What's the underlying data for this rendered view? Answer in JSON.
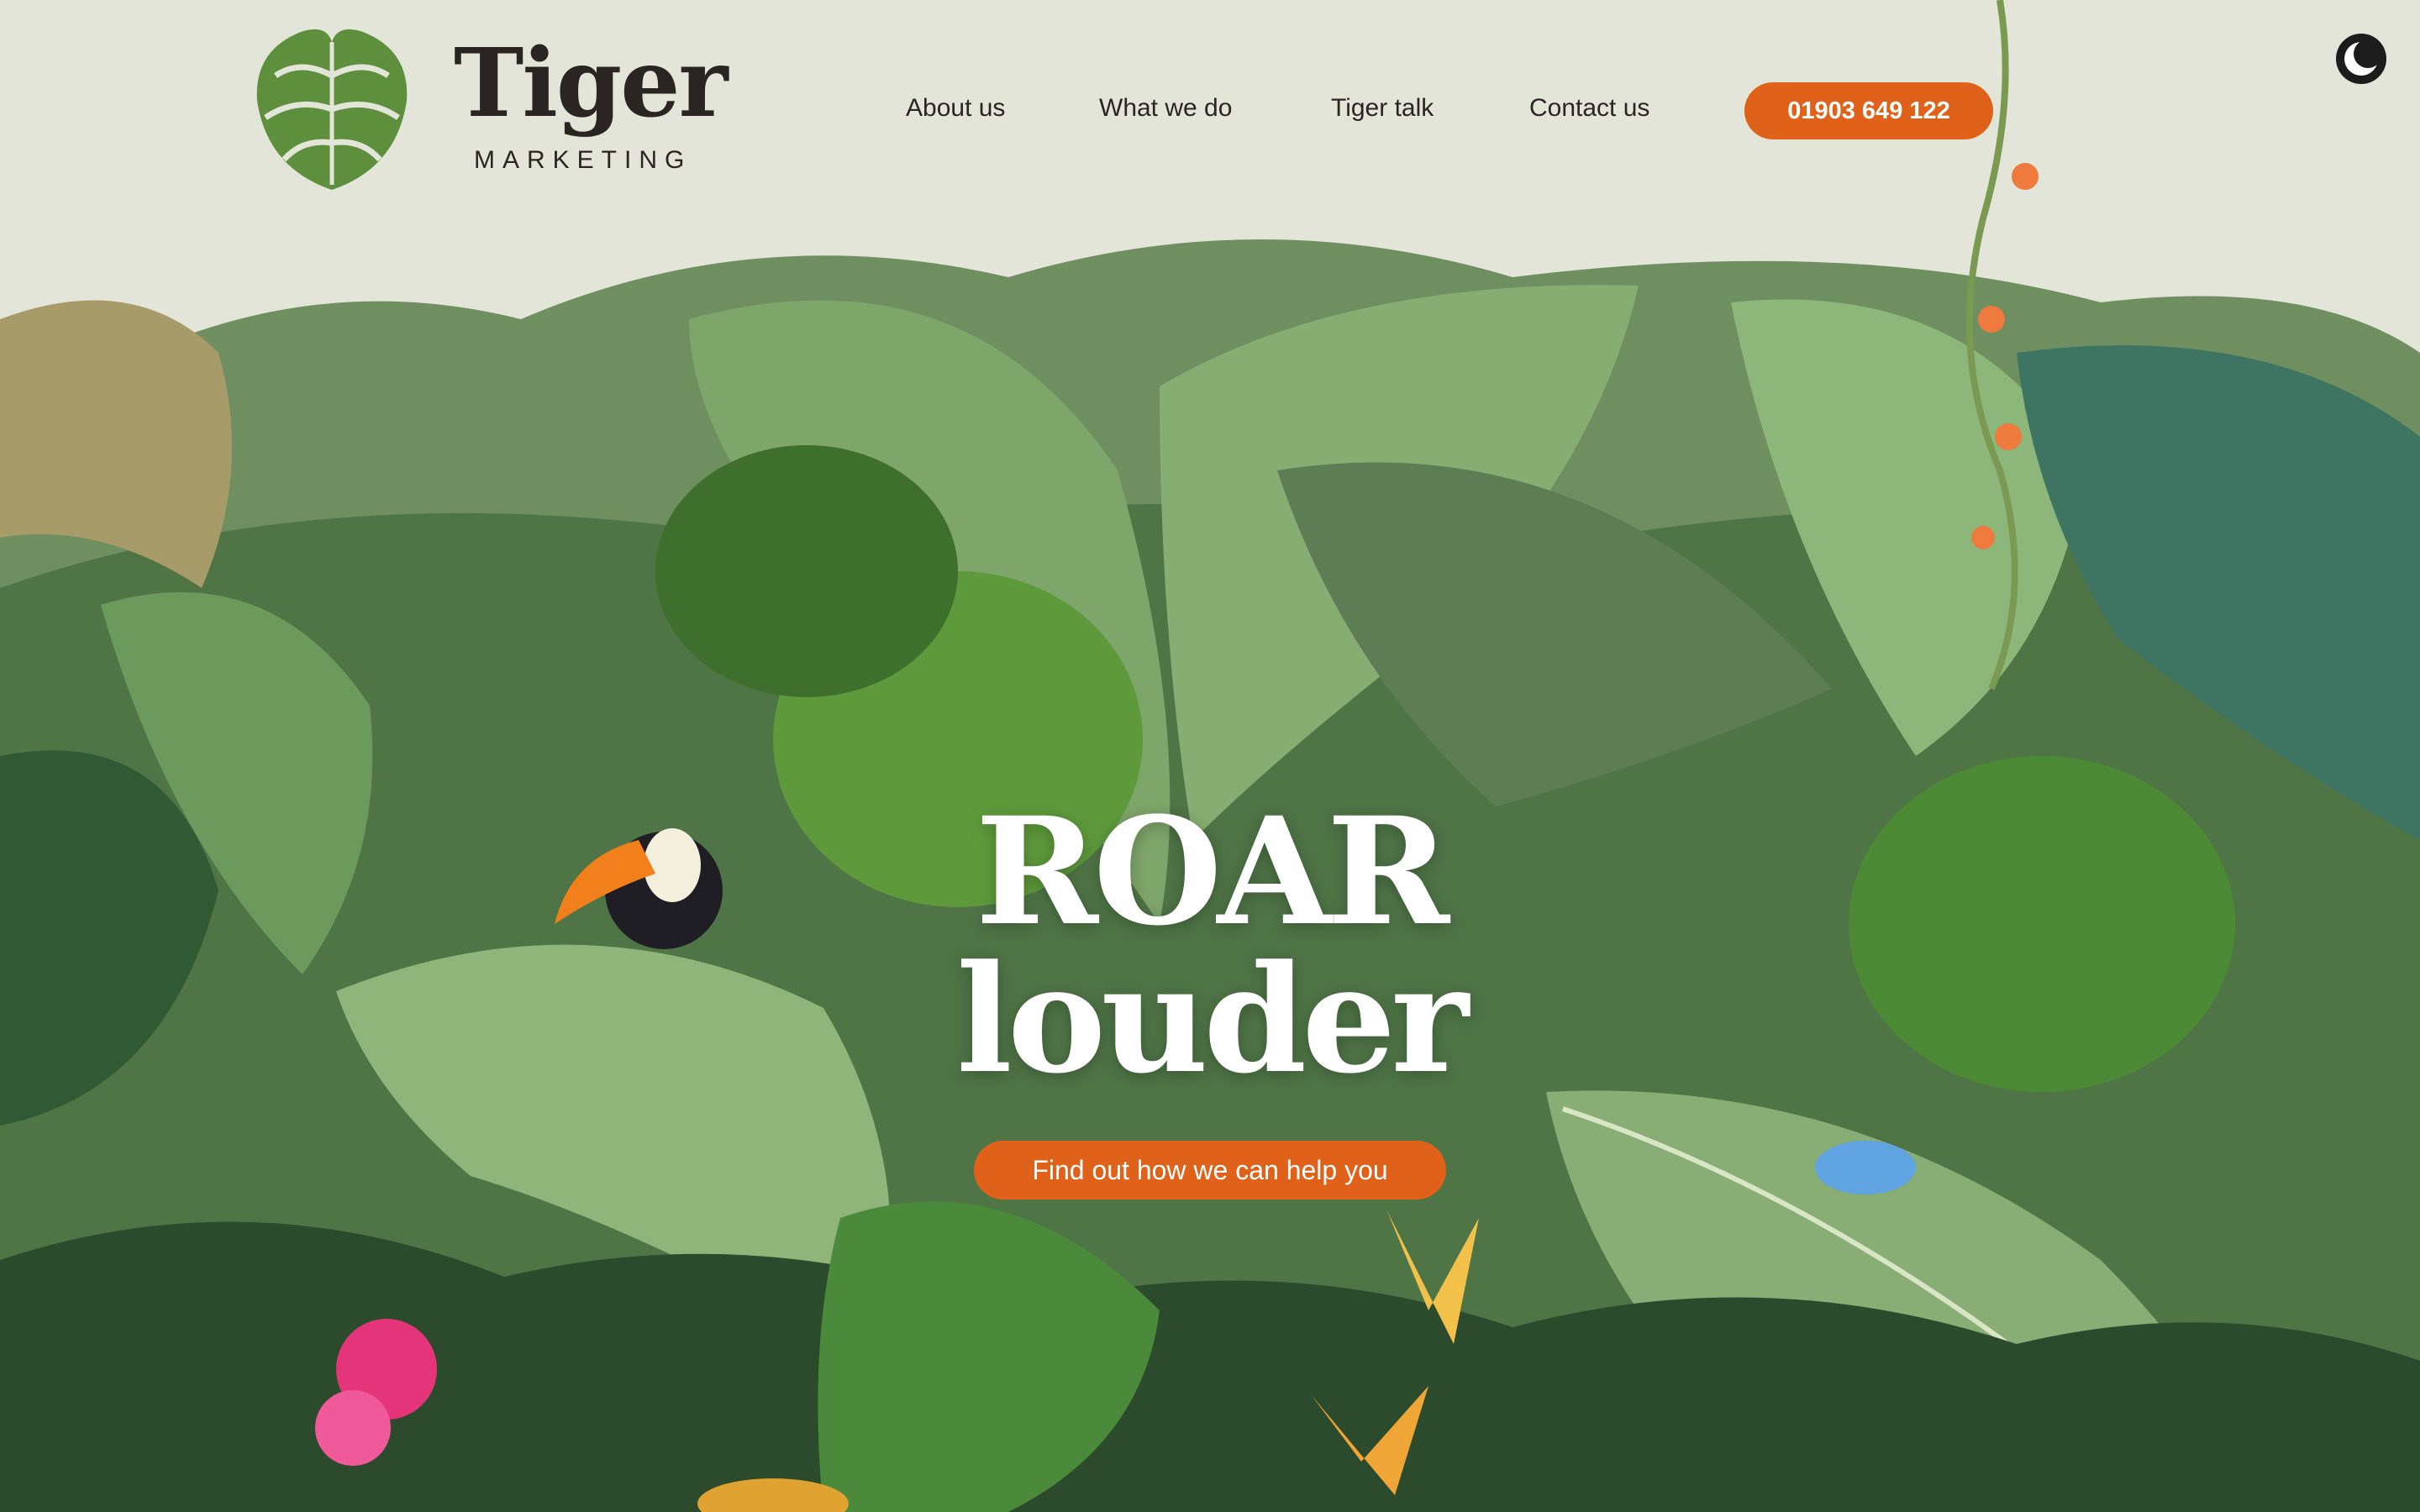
{
  "brand": {
    "name": "Tiger",
    "tagline": "MARKETING",
    "logo_icon": "monstera-leaf-icon"
  },
  "nav": {
    "items": [
      {
        "label": "About us"
      },
      {
        "label": "What we do"
      },
      {
        "label": "Tiger talk"
      },
      {
        "label": "Contact us"
      }
    ],
    "phone": "01903 649 122"
  },
  "theme_toggle": {
    "icon": "moon-icon"
  },
  "hero": {
    "title_line1": "ROAR",
    "title_line2": "louder",
    "cta": "Find out how we can help you",
    "illustration": "jungle-illustration"
  },
  "colors": {
    "background": "#e2e5d8",
    "accent": "#e0621a",
    "text": "#2a2522",
    "hero_text": "#ffffff"
  }
}
